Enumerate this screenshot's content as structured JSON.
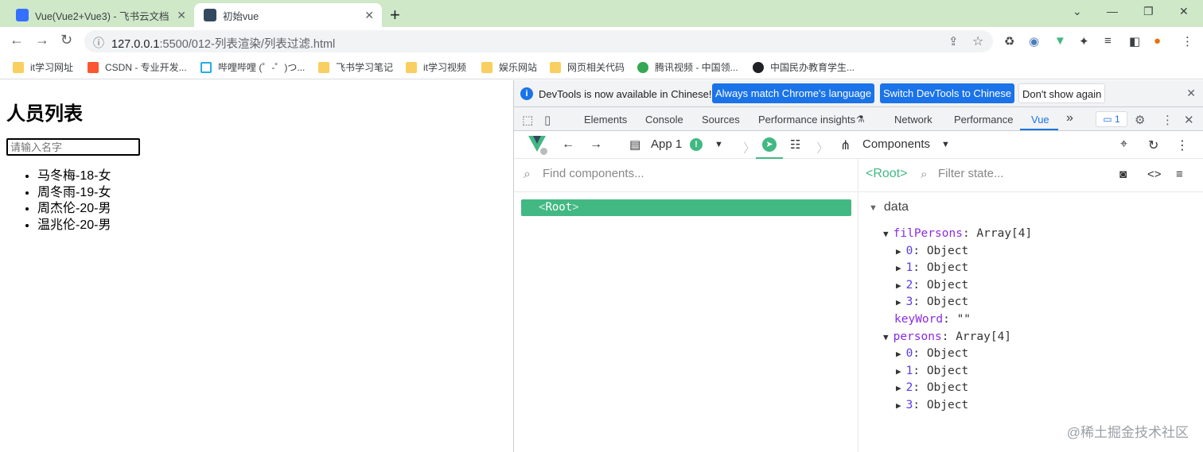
{
  "browser": {
    "tabs": [
      {
        "title": "Vue(Vue2+Vue3) - 飞书云文档",
        "active": false
      },
      {
        "title": "初始vue",
        "active": true
      }
    ],
    "new_tab": "+",
    "window_controls": {
      "minimize": "—",
      "restore": "❐",
      "close": "✕",
      "dropdown": "⌄"
    },
    "url_host": "127.0.0.1",
    "url_path": ":5500/012-列表渲染/列表过滤.html",
    "bookmarks": [
      "it学习网址",
      "CSDN - 专业开发...",
      "哔哩哔哩 (゜-゜)つ...",
      "飞书学习笔记",
      "it学习视频",
      "娱乐网站",
      "网页相关代码",
      "腾讯视频 - 中国领...",
      "中国民办教育学生..."
    ]
  },
  "page": {
    "title": "人员列表",
    "search_placeholder": "请输入名字",
    "persons": [
      "马冬梅-18-女",
      "周冬雨-19-女",
      "周杰伦-20-男",
      "温兆伦-20-男"
    ]
  },
  "devtools": {
    "infobar": {
      "message": "DevTools is now available in Chinese!",
      "btn_match": "Always match Chrome's language",
      "btn_switch": "Switch DevTools to Chinese",
      "btn_dismiss": "Don't show again"
    },
    "tabs": [
      "Elements",
      "Console",
      "Sources",
      "Performance insights",
      "Network",
      "Performance",
      "Vue"
    ],
    "more_tabs": "»",
    "issues_badge": "1",
    "vue": {
      "app_label": "App 1",
      "components_label": "Components",
      "find_placeholder": "Find components...",
      "root_node": "Root",
      "selected_label": "<Root>",
      "filter_placeholder": "Filter state...",
      "data_section": "data",
      "state": [
        {
          "indent": 0,
          "arrow": "▼",
          "key": "filPersons",
          "sep": ": ",
          "value": "Array[4]",
          "idx": false
        },
        {
          "indent": 1,
          "arrow": "▶",
          "key": "0",
          "sep": ": ",
          "value": "Object",
          "idx": true
        },
        {
          "indent": 1,
          "arrow": "▶",
          "key": "1",
          "sep": ": ",
          "value": "Object",
          "idx": true
        },
        {
          "indent": 1,
          "arrow": "▶",
          "key": "2",
          "sep": ": ",
          "value": "Object",
          "idx": true
        },
        {
          "indent": 1,
          "arrow": "▶",
          "key": "3",
          "sep": ": ",
          "value": "Object",
          "idx": true
        },
        {
          "indent": 0,
          "arrow": "",
          "key": "keyWord",
          "sep": ": ",
          "value": "\"\"",
          "idx": false
        },
        {
          "indent": 0,
          "arrow": "▼",
          "key": "persons",
          "sep": ": ",
          "value": "Array[4]",
          "idx": false
        },
        {
          "indent": 1,
          "arrow": "▶",
          "key": "0",
          "sep": ": ",
          "value": "Object",
          "idx": true
        },
        {
          "indent": 1,
          "arrow": "▶",
          "key": "1",
          "sep": ": ",
          "value": "Object",
          "idx": true
        },
        {
          "indent": 1,
          "arrow": "▶",
          "key": "2",
          "sep": ": ",
          "value": "Object",
          "idx": true
        },
        {
          "indent": 1,
          "arrow": "▶",
          "key": "3",
          "sep": ": ",
          "value": "Object",
          "idx": true
        }
      ]
    }
  },
  "watermark": "@稀土掘金技术社区",
  "colors": {
    "vue_green": "#42b883",
    "chrome_blue": "#1a73e8",
    "tabstrip": "#cfe8c8"
  }
}
